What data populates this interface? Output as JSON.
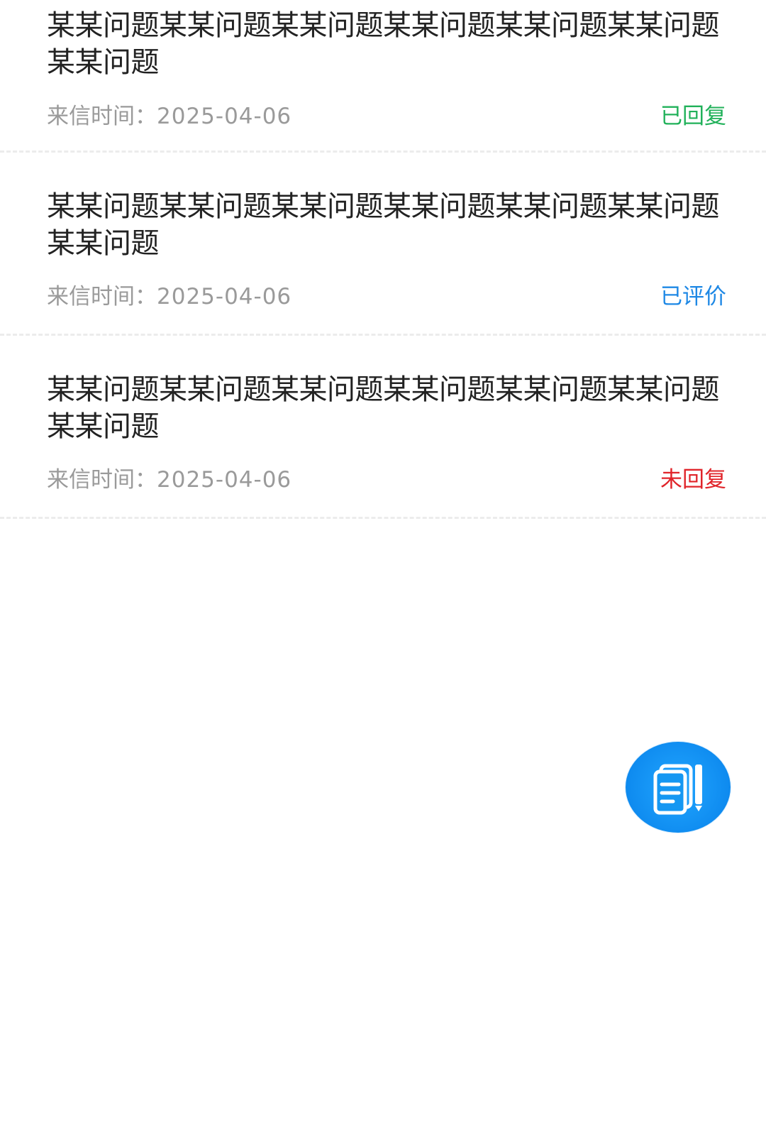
{
  "list": {
    "date_label": "来信时间：",
    "items": [
      {
        "title": "某某问题某某问题某某问题某某问题某某问题某某问题某某问题",
        "date": "2025-04-06",
        "status": "已回复",
        "status_color": "#21b15a"
      },
      {
        "title": "某某问题某某问题某某问题某某问题某某问题某某问题某某问题",
        "date": "2025-04-06",
        "status": "已评价",
        "status_color": "#1e88e5"
      },
      {
        "title": "某某问题某某问题某某问题某某问题某某问题某某问题某某问题",
        "date": "2025-04-06",
        "status": "未回复",
        "status_color": "#e0242a"
      }
    ]
  },
  "fab": {
    "icon": "write-letter-icon",
    "color": "#0f8cf0"
  }
}
